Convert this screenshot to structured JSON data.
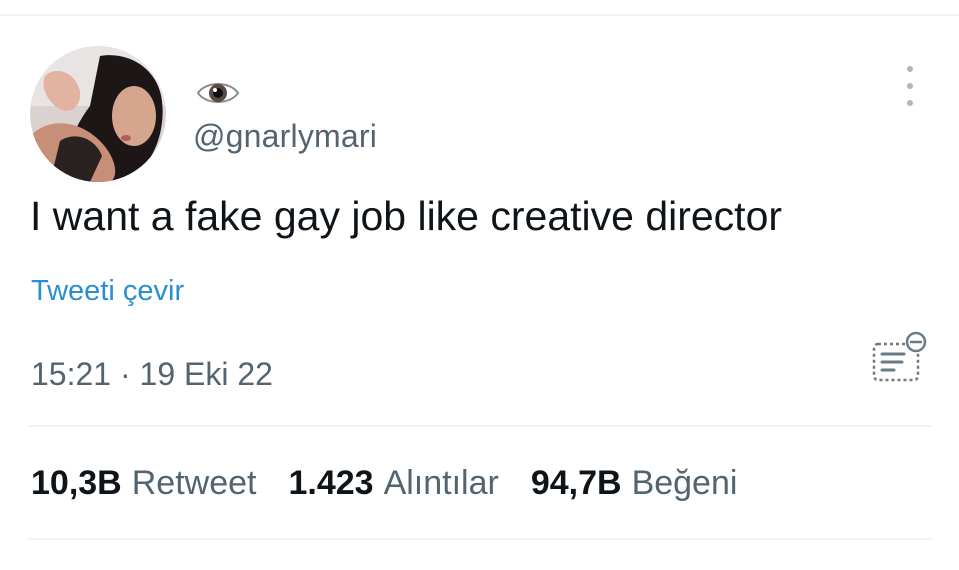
{
  "tweet": {
    "display_name_icon": "eye-icon",
    "handle": "@gnarlymari",
    "text": "I want a fake gay job like creative director",
    "translate_label": "Tweeti çevir",
    "timestamp": "15:21 · 19 Eki 22",
    "stats": {
      "retweets_count": "10,3B",
      "retweets_label": "Retweet",
      "quotes_count": "1.423",
      "quotes_label": "Alıntılar",
      "likes_count": "94,7B",
      "likes_label": "Beğeni"
    }
  },
  "icons": {
    "more": "more-vertical-icon",
    "notes": "community-notes-icon"
  },
  "colors": {
    "link": "#2a8fd0",
    "text_primary": "#0f1419",
    "text_secondary": "#536471",
    "divider": "#eff3f4"
  }
}
